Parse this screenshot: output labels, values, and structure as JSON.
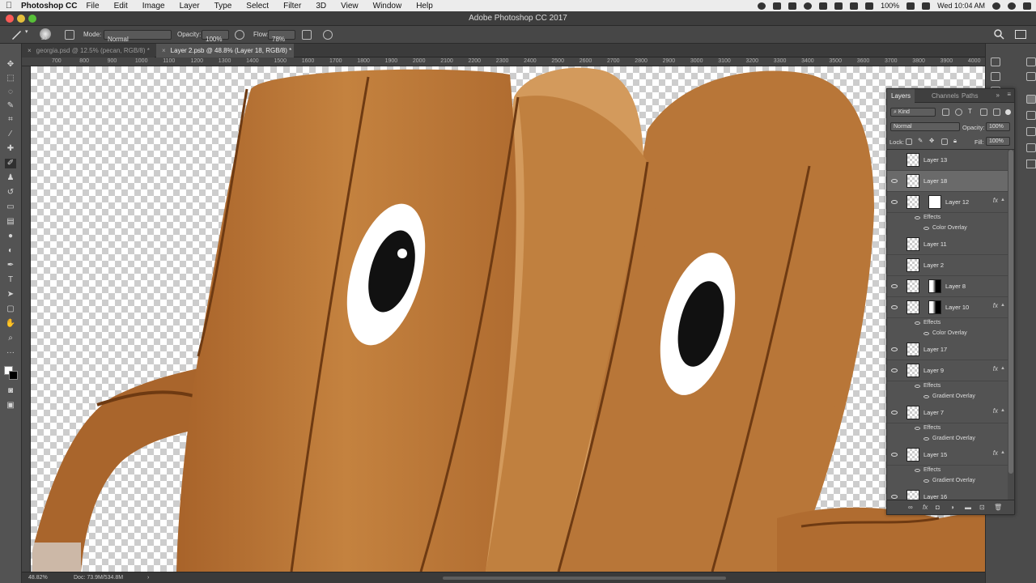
{
  "menubar": {
    "app": "Photoshop CC",
    "items": [
      "File",
      "Edit",
      "Image",
      "Layer",
      "Type",
      "Select",
      "Filter",
      "3D",
      "View",
      "Window",
      "Help"
    ],
    "battery": "100%",
    "clock": "Wed 10:04 AM"
  },
  "window": {
    "title": "Adobe Photoshop CC 2017"
  },
  "options": {
    "brush_size": "30",
    "mode_label": "Mode:",
    "mode_value": "Normal",
    "opacity_label": "Opacity:",
    "opacity_value": "100%",
    "flow_label": "Flow:",
    "flow_value": "78%"
  },
  "tabs": [
    {
      "label": "georgia.psd @ 12.5% (pecan, RGB/8) *"
    },
    {
      "label": "Layer 2.psb @ 48.8% (Layer 18, RGB/8) *"
    }
  ],
  "ruler": {
    "ticks": [
      "700",
      "800",
      "900",
      "1000",
      "1100",
      "1200",
      "1300",
      "1400",
      "1500",
      "1600",
      "1700",
      "1800",
      "1900",
      "2000",
      "2100",
      "2200",
      "2300",
      "2400",
      "2500",
      "2600",
      "2700",
      "2800",
      "2900",
      "3000",
      "3100",
      "3200",
      "3300",
      "3400",
      "3500",
      "3600",
      "3700",
      "3800",
      "3900",
      "4000",
      "410"
    ]
  },
  "status": {
    "zoom": "48.82%",
    "doc": "Doc: 73.9M/534.8M"
  },
  "panel": {
    "tabs": [
      "Layers",
      "Channels",
      "Paths"
    ],
    "filter_label": "Kind",
    "blend_mode": "Normal",
    "opacity_label": "Opacity:",
    "opacity_value": "100%",
    "lock_label": "Lock:",
    "fill_label": "Fill:",
    "fill_value": "100%",
    "layers": [
      {
        "name": "Layer 13",
        "visible": false,
        "selected": false
      },
      {
        "name": "Layer 18",
        "visible": true,
        "selected": true
      },
      {
        "name": "Layer 12",
        "visible": true,
        "selected": false,
        "fx": "fx",
        "effects_label": "Effects",
        "effects": [
          "Color Overlay"
        ]
      },
      {
        "name": "Layer 11",
        "visible": false,
        "selected": false
      },
      {
        "name": "Layer 2",
        "visible": false,
        "selected": false
      },
      {
        "name": "Layer 8",
        "visible": true,
        "selected": false
      },
      {
        "name": "Layer 10",
        "visible": true,
        "selected": false,
        "fx": "fx",
        "effects_label": "Effects",
        "effects": [
          "Color Overlay"
        ]
      },
      {
        "name": "Layer 17",
        "visible": true,
        "selected": false
      },
      {
        "name": "Layer 9",
        "visible": true,
        "selected": false,
        "fx": "fx",
        "effects_label": "Effects",
        "effects": [
          "Gradient Overlay"
        ]
      },
      {
        "name": "Layer 7",
        "visible": true,
        "selected": false,
        "fx": "fx",
        "effects_label": "Effects",
        "effects": [
          "Gradient Overlay"
        ]
      },
      {
        "name": "Layer 15",
        "visible": true,
        "selected": false,
        "fx": "fx",
        "effects_label": "Effects",
        "effects": [
          "Gradient Overlay"
        ]
      },
      {
        "name": "Layer 16",
        "visible": true,
        "selected": false
      }
    ]
  },
  "colors": {
    "wood": "#b87638",
    "wood_light": "#d39a5c",
    "wood_dark": "#7a4418",
    "ui_bg": "#535353"
  }
}
